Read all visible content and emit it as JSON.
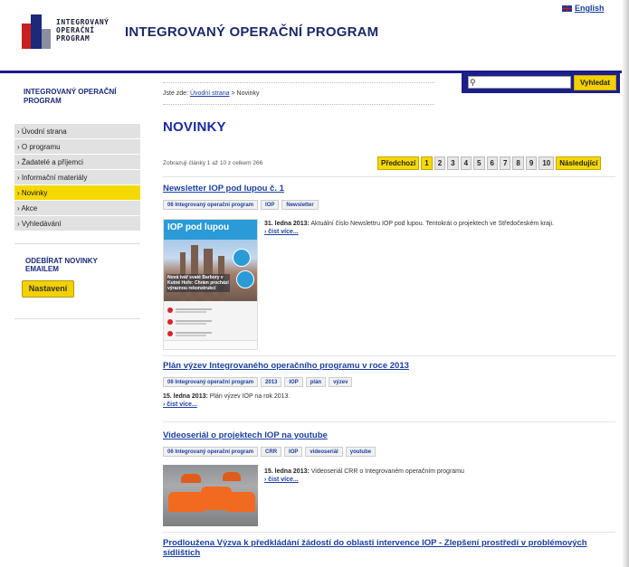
{
  "header": {
    "logo_lines": [
      "INTEGROVANÝ",
      "OPERAČNÍ",
      "PROGRAM"
    ],
    "site_title": "INTEGROVANÝ OPERAČNÍ PROGRAM",
    "language_link": "English",
    "flag_icon": "uk-flag-icon"
  },
  "search": {
    "placeholder": "",
    "button_label": "Vyhledat",
    "icon": "search-icon"
  },
  "sidebar": {
    "title": "INTEGROVANÝ OPERAČNÍ PROGRAM",
    "items": [
      {
        "label": "› Úvodní strana",
        "active": false
      },
      {
        "label": "› O programu",
        "active": false
      },
      {
        "label": "› Žadatelé a příjemci",
        "active": false
      },
      {
        "label": "› Informační materiály",
        "active": false
      },
      {
        "label": "› Novinky",
        "active": true
      },
      {
        "label": "› Akce",
        "active": false
      },
      {
        "label": "› Vyhledávání",
        "active": false
      }
    ],
    "subscribe_title": "ODEBÍRAT NOVINKY EMAILEM",
    "settings_button": "Nastavení"
  },
  "main": {
    "breadcrumb_prefix": "Jste zde:",
    "breadcrumb_home": "Úvodní strana",
    "breadcrumb_current": "> Novinky",
    "page_title": "NOVINKY",
    "results_text": "Zobrazuji články 1 až 10 z celkem 266",
    "pager": {
      "prev": "Předchozí",
      "pages": [
        "1",
        "2",
        "3",
        "4",
        "5",
        "6",
        "7",
        "8",
        "9",
        "10"
      ],
      "current": "1",
      "next": "Následující"
    },
    "articles": [
      {
        "title": "Newsletter IOP pod lupou č. 1",
        "tags": [
          "06 Integrovaný operační program",
          "IOP",
          "Newsletter"
        ],
        "date": "31. ledna 2013:",
        "text": "Aktuální číslo Newslettru IOP pod lupou. Tentokrát o projektech ve Středočeském kraji.",
        "more": "› čist více...",
        "thumb_title": "IOP pod lupou",
        "thumb_caption": "Nová tvář svaté Barbory v Kutné Hoře: Chrám prochází výraznou rekonstrukcí"
      },
      {
        "title": "Plán výzev Integrovaného operačního programu v roce 2013",
        "tags": [
          "06 Integrovaný operační program",
          "2013",
          "IOP",
          "plán",
          "výzev"
        ],
        "date": "15. ledna 2013:",
        "text": "Plán výzev IOP na rok 2013.",
        "more": "› čist více..."
      },
      {
        "title": "Videoseriál o projektech IOP na youtube",
        "tags": [
          "06 Integrovaný operační program",
          "CRR",
          "IOP",
          "videoseriál",
          "youtube"
        ],
        "date": "15. ledna 2013:",
        "text": "Videoseriál CRR o Integrovaném operačním programu",
        "more": "› čist více..."
      },
      {
        "title": "Prodloužena Výzva k předkládání žádostí do oblasti intervence IOP - Zlepšení prostředí v problémových",
        "title_line2": "sídlištích"
      }
    ]
  }
}
